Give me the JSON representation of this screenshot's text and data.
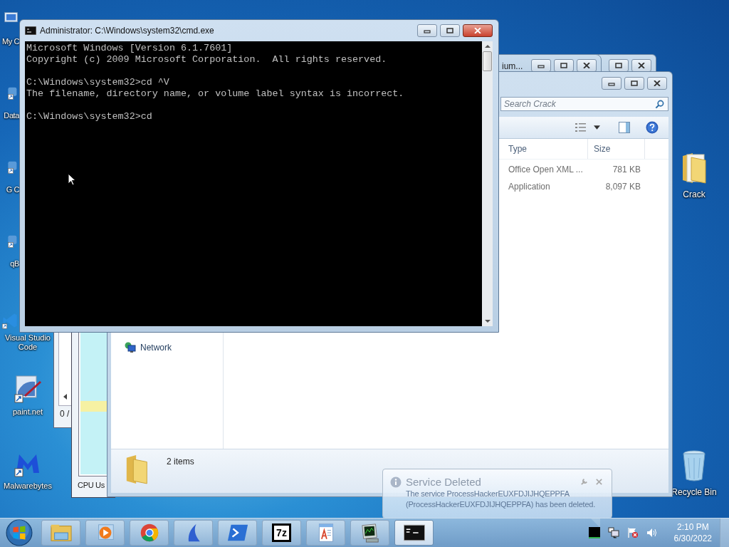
{
  "desktop_icons_left": [
    {
      "label": "My C",
      "kind": "computer"
    },
    {
      "label": "Data",
      "kind": "shortcut"
    },
    {
      "label": "G C",
      "kind": "shortcut"
    },
    {
      "label": "qB",
      "kind": "shortcut"
    },
    {
      "label": "Visual Studio Code",
      "kind": "vscode"
    },
    {
      "label": "paint.net",
      "kind": "paint"
    },
    {
      "label": "Malwarebytes",
      "kind": "malware"
    }
  ],
  "desktop_icons_right": [
    {
      "label": "Crack",
      "kind": "folder"
    },
    {
      "label": "Recycle Bin",
      "kind": "bin"
    }
  ],
  "back_window": {
    "title": "ium..."
  },
  "task_manager": {
    "counter": "0 /",
    "graph_label": "CPU Us"
  },
  "explorer": {
    "search": {
      "placeholder": "Search Crack"
    },
    "columns": [
      "Type",
      "Size"
    ],
    "rows": [
      {
        "type": "Office Open XML ...",
        "size": "781 KB"
      },
      {
        "type": "Application",
        "size": "8,097 KB"
      }
    ],
    "nav_items": [
      "Network"
    ],
    "status": "2 items"
  },
  "cmd_window": {
    "title": "Administrator: C:\\Windows\\system32\\cmd.exe",
    "blocks": [
      [
        "Microsoft Windows [Version 6.1.7601]",
        "Copyright (c) 2009 Microsoft Corporation.  All rights reserved."
      ],
      [
        "C:\\Windows\\system32>cd ^V",
        "The filename, directory name, or volume label syntax is incorrect."
      ],
      [
        "C:\\Windows\\system32>cd"
      ]
    ]
  },
  "notification": {
    "title": "Service Deleted",
    "message": "The service ProcessHackerEUXFDJIJHQEPPFA (ProcessHackerEUXFDJIJHQEPPFA) has been deleted."
  },
  "taskbar": {
    "buttons": [
      {
        "kind": "explorer",
        "active": false
      },
      {
        "kind": "media",
        "active": false
      },
      {
        "kind": "chrome",
        "active": false
      },
      {
        "kind": "shark",
        "active": false
      },
      {
        "kind": "powershell",
        "active": false
      },
      {
        "kind": "sevenzip",
        "label": "7z",
        "active": false
      },
      {
        "kind": "wordpad",
        "active": false
      },
      {
        "kind": "monitor",
        "active": false
      },
      {
        "kind": "cmd",
        "active": true
      }
    ],
    "clock": {
      "time": "2:10 PM",
      "date": "6/30/2022"
    }
  }
}
